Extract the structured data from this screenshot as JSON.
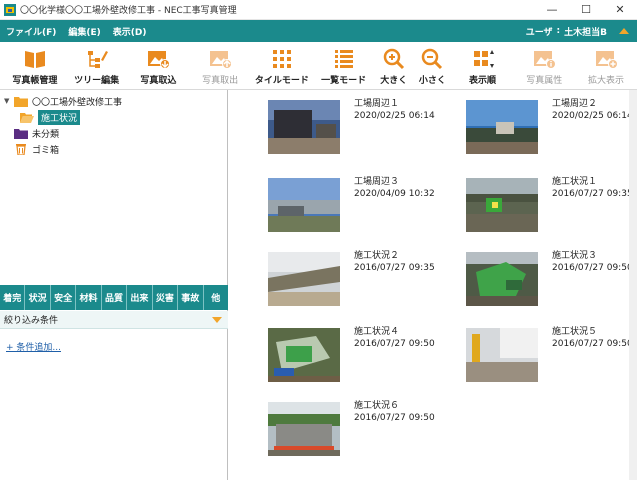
{
  "window": {
    "title": "〇〇化学様〇〇工場外壁改修工事 - NEC工事写真管理",
    "min_glyph": "—",
    "max_glyph": "☐",
    "close_glyph": "✕"
  },
  "menu": {
    "items": [
      "ファイル(F)",
      "編集(E)",
      "表示(D)"
    ],
    "user_label": "ユーザ",
    "user_sep": ":",
    "user_name": "土木担当B"
  },
  "toolbar": {
    "buttons": [
      {
        "label": "写真帳管理",
        "icon": "photo-book-icon",
        "enabled": true
      },
      {
        "label": "ツリー編集",
        "icon": "tree-edit-icon",
        "enabled": true
      },
      {
        "label": "写真取込",
        "icon": "photo-import-icon",
        "enabled": true
      },
      {
        "label": "写真取出",
        "icon": "photo-export-icon",
        "enabled": false
      },
      {
        "label": "タイルモード",
        "icon": "tile-mode-icon",
        "enabled": true
      },
      {
        "label": "一覧モード",
        "icon": "list-mode-icon",
        "enabled": true
      },
      {
        "label": "大きく",
        "icon": "zoom-in-icon",
        "enabled": true
      },
      {
        "label": "小さく",
        "icon": "zoom-out-icon",
        "enabled": true
      },
      {
        "label": "表示順",
        "icon": "sort-order-icon",
        "enabled": true
      },
      {
        "label": "写真属性",
        "icon": "photo-attributes-icon",
        "enabled": false
      },
      {
        "label": "拡大表示",
        "icon": "enlarge-view-icon",
        "enabled": false
      }
    ]
  },
  "tree": {
    "root": {
      "label": "〇〇工場外壁改修工事",
      "expander": "▼"
    },
    "child": {
      "label": "施工状況"
    },
    "unsorted": {
      "label": "未分類"
    },
    "trash": {
      "label": "ゴミ箱"
    }
  },
  "filters": {
    "tabs": [
      "着完",
      "状況",
      "安全",
      "材料",
      "品質",
      "出来",
      "災害",
      "事故",
      "他"
    ],
    "condition_label": "絞り込み条件",
    "add_condition": "+ 条件追加..."
  },
  "photos": [
    {
      "name": "工場周辺１",
      "date": "2020/02/25 06:14"
    },
    {
      "name": "工場周辺２",
      "date": "2020/02/25 06:14"
    },
    {
      "name": "工場周辺３",
      "date": "2020/04/09 10:32"
    },
    {
      "name": "施工状況１",
      "date": "2016/07/27 09:35"
    },
    {
      "name": "施工状況２",
      "date": "2016/07/27 09:35"
    },
    {
      "name": "施工状況３",
      "date": "2016/07/27 09:50"
    },
    {
      "name": "施工状況４",
      "date": "2016/07/27 09:50"
    },
    {
      "name": "施工状況５",
      "date": "2016/07/27 09:50"
    },
    {
      "name": "施工状況６",
      "date": "2016/07/27 09:50"
    }
  ],
  "colors": {
    "accent": "#1b8a8c",
    "toolbar_icon": "#e98a1f",
    "caret": "#f2a52a"
  }
}
